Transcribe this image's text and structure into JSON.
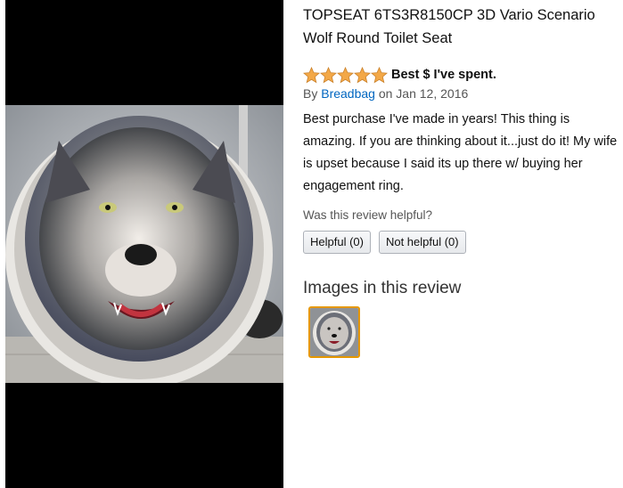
{
  "product": {
    "title": "TOPSEAT 6TS3R8150CP 3D Vario Scenario Wolf Round Toilet Seat"
  },
  "review": {
    "rating": 5,
    "rating_max": 5,
    "headline": "Best $ I've spent.",
    "by_prefix": "By",
    "author": "Breadbag",
    "date": "on Jan 12, 2016",
    "body": "Best purchase I've made in years! This thing is amazing. If you are thinking about it...just do it! My wife is upset because I said its up there w/ buying her engagement ring."
  },
  "helpful": {
    "question": "Was this review helpful?",
    "helpful_label": "Helpful (0)",
    "not_helpful_label": "Not helpful (0)"
  },
  "images_section": {
    "heading": "Images in this review"
  },
  "colors": {
    "star": "#f3a847",
    "link": "#0066c0",
    "thumb_border": "#e59700"
  }
}
